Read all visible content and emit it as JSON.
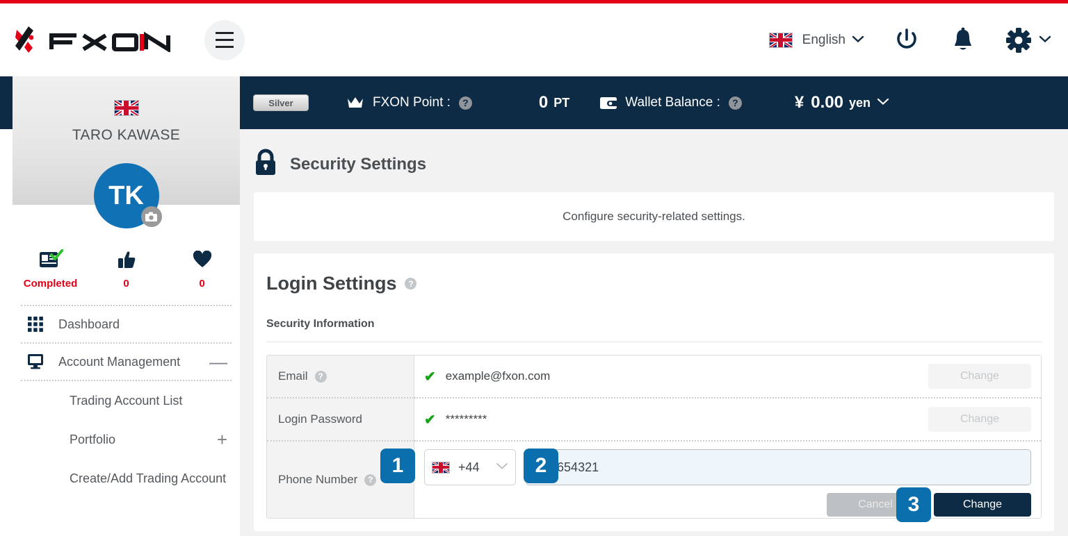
{
  "brand": {
    "name": "FXON",
    "accent_red": "#e30016",
    "navy": "#0d2b45",
    "blue": "#0b6fad"
  },
  "header": {
    "menu_icon": "hamburger-icon",
    "language": {
      "label": "English",
      "flag": "uk-flag-icon",
      "chevron": "chevron-down-icon"
    },
    "icons": [
      {
        "name": "power-icon"
      },
      {
        "name": "bell-icon"
      },
      {
        "name": "gear-icon"
      }
    ]
  },
  "statusbar": {
    "tier": "Silver",
    "point_label": "FXON Point :",
    "point_value": "0",
    "point_unit": "PT",
    "wallet_label": "Wallet Balance :",
    "wallet_symbol": "¥",
    "wallet_value": "0.00",
    "wallet_currency": "yen",
    "help": "?"
  },
  "sidebar": {
    "flag": "uk-flag-icon",
    "user_name": "TARO KAWASE",
    "avatar_initials": "TK",
    "stats": [
      {
        "icon": "id-verified-icon",
        "value": "Completed"
      },
      {
        "icon": "thumbs-up-icon",
        "value": "0"
      },
      {
        "icon": "heart-icon",
        "value": "0"
      }
    ],
    "items": [
      {
        "label": "Dashboard",
        "icon": "grid-icon",
        "expand": ""
      },
      {
        "label": "Account Management",
        "icon": "monitor-icon",
        "expand": "—"
      }
    ],
    "sub_items": [
      {
        "label": "Trading Account List",
        "expand": ""
      },
      {
        "label": "Portfolio",
        "expand": "+"
      },
      {
        "label": "Create/Add Trading Account",
        "expand": ""
      }
    ]
  },
  "main": {
    "page_icon": "lock-icon",
    "page_title": "Security Settings",
    "description": "Configure security-related settings.",
    "section_title": "Login Settings",
    "section_help": "?",
    "subsection_title": "Security Information",
    "rows": [
      {
        "label": "Email",
        "has_help": true,
        "verified": true,
        "value": "example@fxon.com",
        "action_label": "Change",
        "action_disabled": true
      },
      {
        "label": "Login Password",
        "has_help": false,
        "verified": true,
        "value": "*********",
        "action_label": "Change",
        "action_disabled": true
      },
      {
        "label": "Phone Number",
        "has_help": true,
        "country_code": "+44",
        "country_flag": "uk-flag-icon",
        "country_chevron": "chevron-down-icon",
        "phone_value": "987654321",
        "phone_placeholder": "",
        "cancel_label": "Cancel",
        "change_label": "Change"
      }
    ]
  },
  "steps": [
    {
      "number": "1"
    },
    {
      "number": "2"
    },
    {
      "number": "3"
    }
  ]
}
